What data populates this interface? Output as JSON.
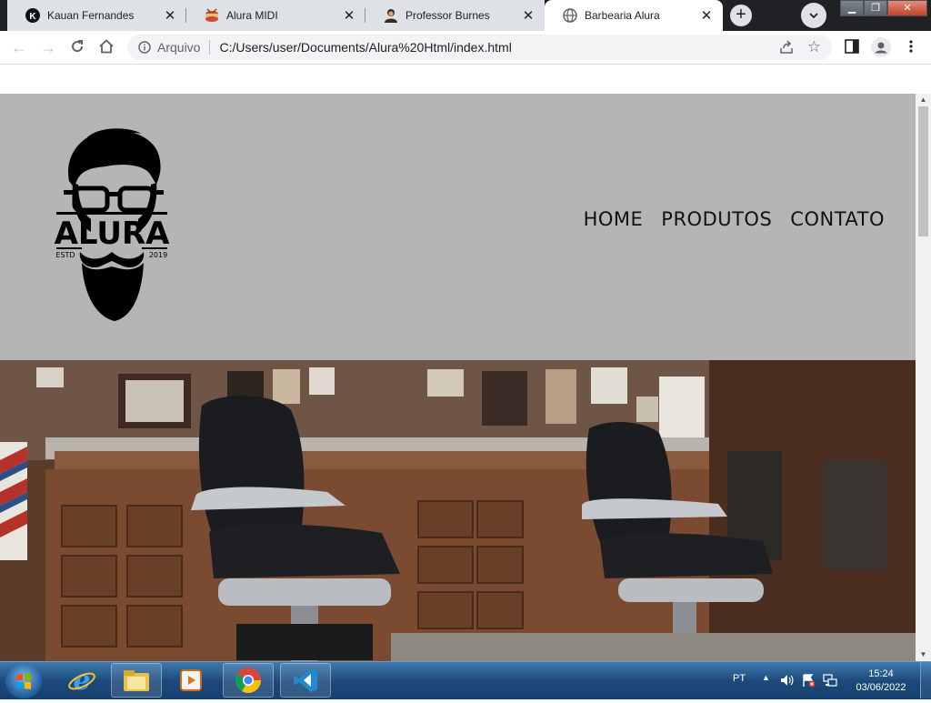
{
  "browser": {
    "tabs": [
      {
        "title": "Kauan Fernandes",
        "favicon": "k-logo-icon",
        "active": false
      },
      {
        "title": "Alura MIDI",
        "favicon": "drum-icon",
        "active": false
      },
      {
        "title": "Professor Burnes",
        "favicon": "person-icon",
        "active": false
      },
      {
        "title": "Barbearia Alura",
        "favicon": "globe-icon",
        "active": true
      }
    ],
    "address": {
      "scheme_label": "Arquivo",
      "url": "C:/Users/user/Documents/Alura%20Html/index.html"
    }
  },
  "site": {
    "logo": {
      "brand": "ALURA",
      "estd_left": "ESTD",
      "estd_right": "2019"
    },
    "nav": [
      {
        "label": "HOME"
      },
      {
        "label": "PRODUTOS"
      },
      {
        "label": "CONTATO"
      }
    ],
    "colors": {
      "header_bg": "#b5b5b5",
      "nav_text": "#111111"
    }
  },
  "taskbar": {
    "apps": [
      "internet-explorer-icon",
      "file-explorer-icon",
      "media-player-icon",
      "chrome-icon",
      "vscode-icon"
    ],
    "language": "PT",
    "time": "15:24",
    "date": "03/06/2022"
  }
}
